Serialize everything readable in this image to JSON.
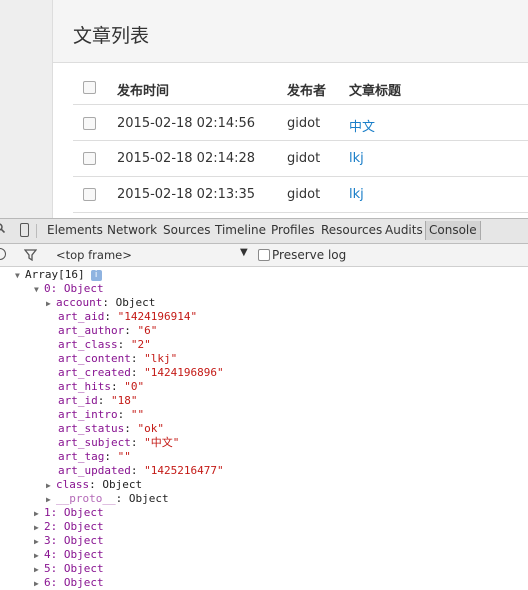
{
  "page": {
    "title": "文章列表",
    "table": {
      "headers": [
        "发布时间",
        "发布者",
        "文章标题"
      ],
      "rows": [
        {
          "time": "2015-02-18 02:14:56",
          "author": "gidot",
          "title": "中文"
        },
        {
          "time": "2015-02-18 02:14:28",
          "author": "gidot",
          "title": "lkj"
        },
        {
          "time": "2015-02-18 02:13:35",
          "author": "gidot",
          "title": "lkj"
        }
      ]
    }
  },
  "devtools": {
    "tabs": [
      "Elements",
      "Network",
      "Sources",
      "Timeline",
      "Profiles",
      "Resources",
      "Audits",
      "Console"
    ],
    "active_tab": "Console",
    "toolbar": {
      "frame": "<top frame>",
      "preserve_log": "Preserve log"
    },
    "console": {
      "array_label": "Array[16]",
      "info_glyph": "i",
      "item0_label": "0: Object",
      "account": {
        "key": "account",
        "value": "Object"
      },
      "fields": [
        {
          "key": "art_aid",
          "value": "\"1424196914\""
        },
        {
          "key": "art_author",
          "value": "\"6\""
        },
        {
          "key": "art_class",
          "value": "\"2\""
        },
        {
          "key": "art_content",
          "value": "\"lkj\""
        },
        {
          "key": "art_created",
          "value": "\"1424196896\""
        },
        {
          "key": "art_hits",
          "value": "\"0\""
        },
        {
          "key": "art_id",
          "value": "\"18\""
        },
        {
          "key": "art_intro",
          "value": "\"\""
        },
        {
          "key": "art_status",
          "value": "\"ok\""
        },
        {
          "key": "art_subject",
          "value": "\"中文\""
        },
        {
          "key": "art_tag",
          "value": "\"\""
        },
        {
          "key": "art_updated",
          "value": "\"1425216477\""
        }
      ],
      "class_row": {
        "key": "class",
        "value": "Object"
      },
      "proto_row": {
        "key": "__proto__",
        "value": "Object"
      },
      "items": [
        "1: Object",
        "2: Object",
        "3: Object",
        "4: Object",
        "5: Object",
        "6: Object"
      ]
    }
  },
  "colors": {
    "link": "#1a7ec8",
    "key": "#881391",
    "string": "#c41a16"
  }
}
